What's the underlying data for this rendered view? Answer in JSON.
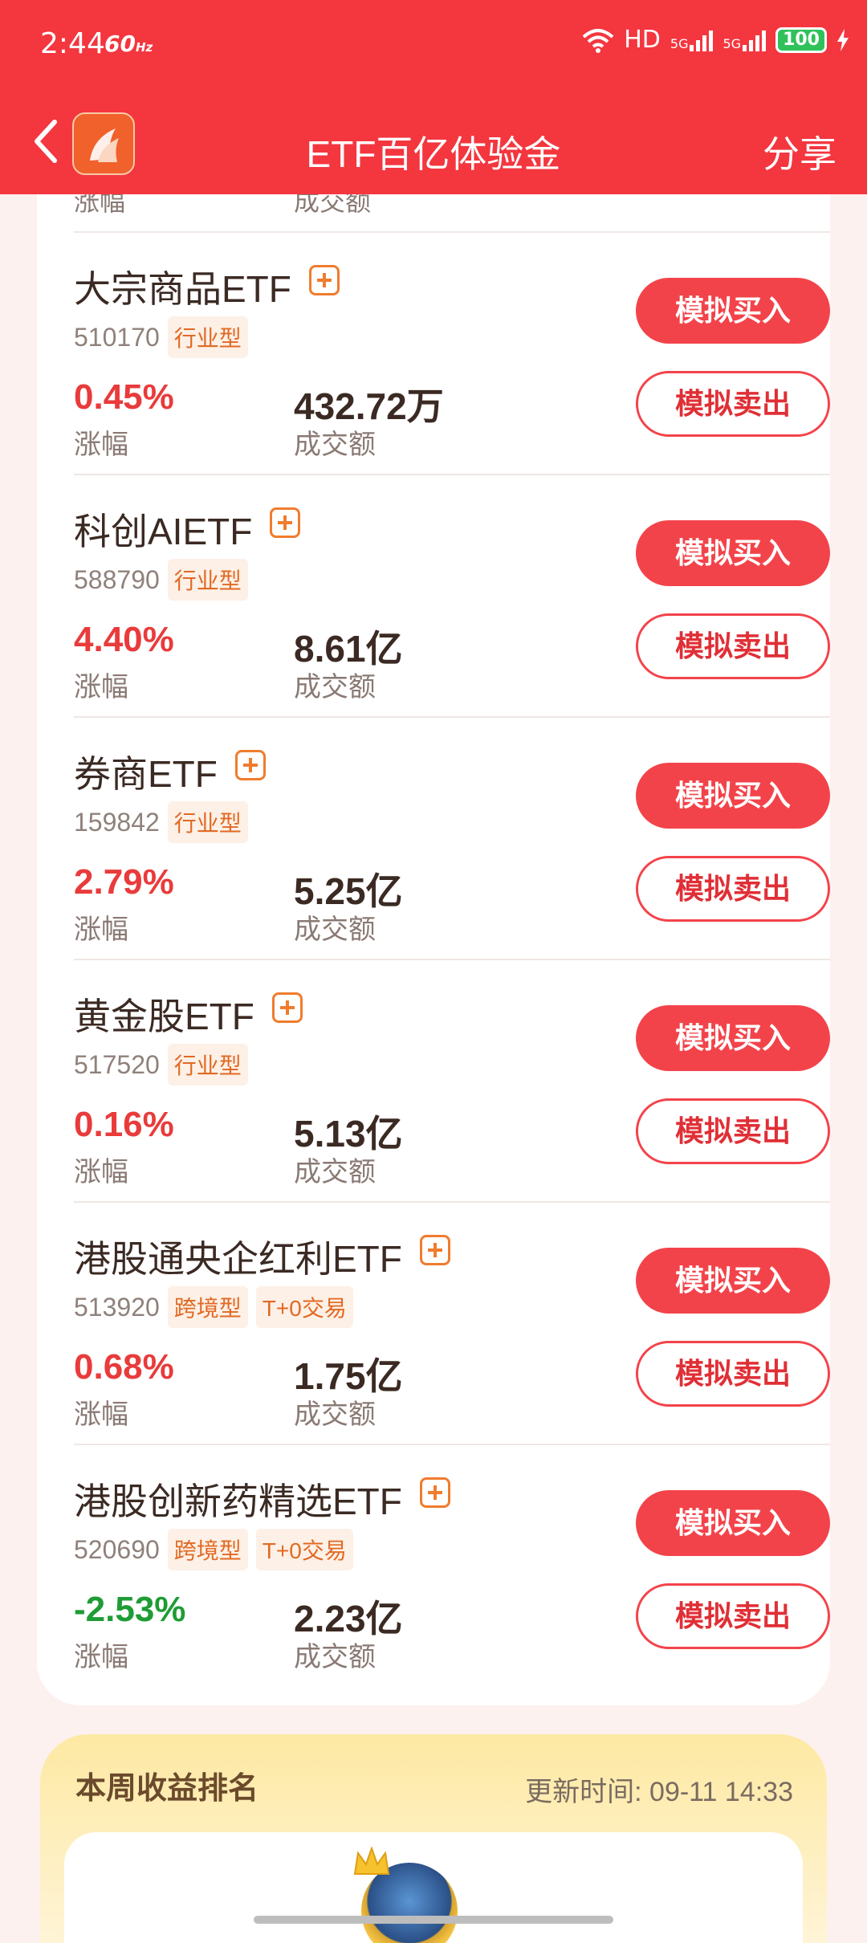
{
  "status": {
    "time": "2:44",
    "refresh": "60",
    "refresh_unit": "Hz",
    "network": "HD",
    "sig1": "5G",
    "sig2": "5G",
    "battery": "100"
  },
  "nav": {
    "title": "ETF百亿体验金",
    "share": "分享"
  },
  "stub": {
    "change_label": "涨幅",
    "amount_label": "成交额"
  },
  "labels": {
    "change": "涨幅",
    "amount": "成交额",
    "buy": "模拟买入",
    "sell": "模拟卖出"
  },
  "etfs": [
    {
      "name": "大宗商品ETF",
      "code": "510170",
      "tags": [
        "行业型"
      ],
      "change": "0.45%",
      "amount": "432.72万"
    },
    {
      "name": "科创AIETF",
      "code": "588790",
      "tags": [
        "行业型"
      ],
      "change": "4.40%",
      "amount": "8.61亿"
    },
    {
      "name": "券商ETF",
      "code": "159842",
      "tags": [
        "行业型"
      ],
      "change": "2.79%",
      "amount": "5.25亿"
    },
    {
      "name": "黄金股ETF",
      "code": "517520",
      "tags": [
        "行业型"
      ],
      "change": "0.16%",
      "amount": "5.13亿"
    },
    {
      "name": "港股通央企红利ETF",
      "code": "513920",
      "tags": [
        "跨境型",
        "T+0交易"
      ],
      "change": "0.68%",
      "amount": "1.75亿"
    },
    {
      "name": "港股创新药精选ETF",
      "code": "520690",
      "tags": [
        "跨境型",
        "T+0交易"
      ],
      "change": "-2.53%",
      "amount": "2.23亿"
    }
  ],
  "ranking": {
    "title": "本周收益排名",
    "update": "更新时间: 09-11 14:33"
  },
  "colors": {
    "brand": "#f4363f",
    "up": "#e93b3b",
    "down": "#1f9c35",
    "tag": "#e16a24"
  }
}
